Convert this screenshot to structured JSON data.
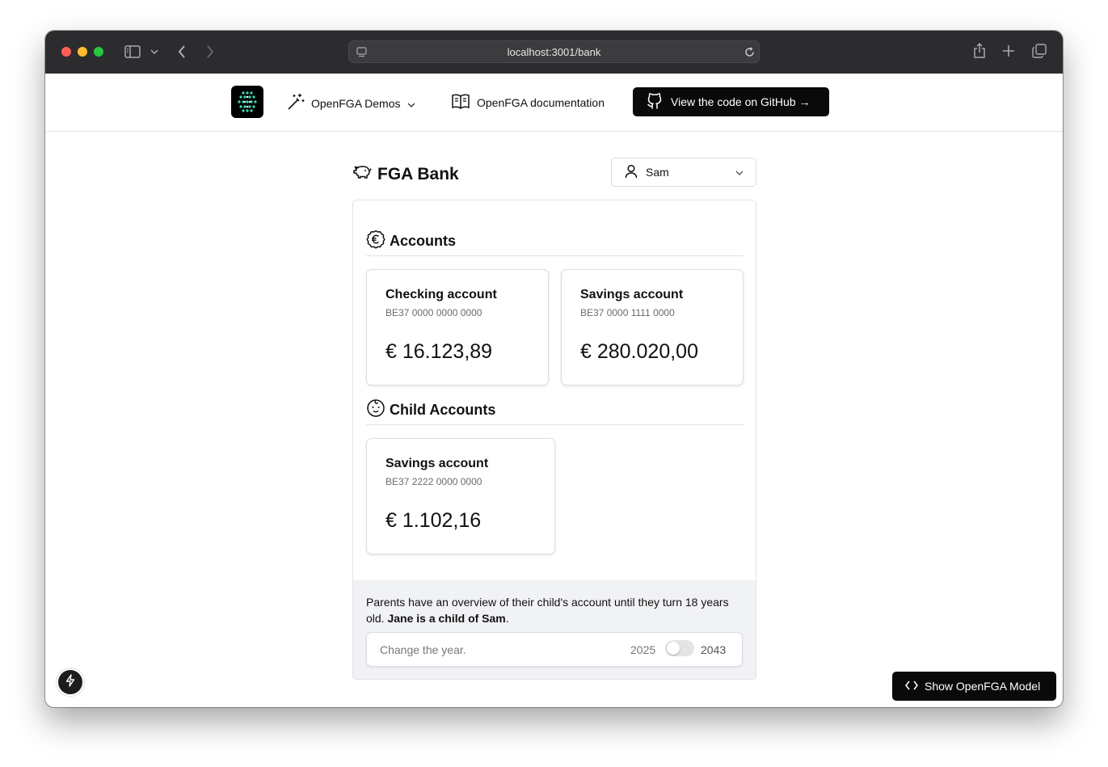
{
  "browser": {
    "url": "localhost:3001/bank"
  },
  "nav": {
    "demos_label": "OpenFGA Demos",
    "docs_label": "OpenFGA documentation",
    "github_label": "View the code on GitHub →"
  },
  "bank": {
    "title": "FGA Bank",
    "user_selected": "Sam"
  },
  "accounts": {
    "title": "Accounts",
    "items": [
      {
        "name": "Checking account",
        "iban": "BE37 0000 0000 0000",
        "balance": "€ 16.123,89"
      },
      {
        "name": "Savings account",
        "iban": "BE37 0000 1111 0000",
        "balance": "€ 280.020,00"
      }
    ]
  },
  "child_accounts": {
    "title": "Child Accounts",
    "items": [
      {
        "name": "Savings account",
        "iban": "BE37 2222 0000 0000",
        "balance": "€ 1.102,16"
      }
    ]
  },
  "footer": {
    "text_normal": "Parents have an overview of their child's account until they turn 18 years old. ",
    "text_bold": "Jane is a child of Sam",
    "text_end": ".",
    "year_label": "Change the year.",
    "year_from": "2025",
    "year_to": "2043",
    "toggle_on": false
  },
  "buttons": {
    "show_model": "Show OpenFGA Model"
  },
  "colors": {
    "dark_button": "#0a0a0a",
    "footer_bg": "#f1f2f5",
    "logo_accent": "#3ddbb5"
  }
}
